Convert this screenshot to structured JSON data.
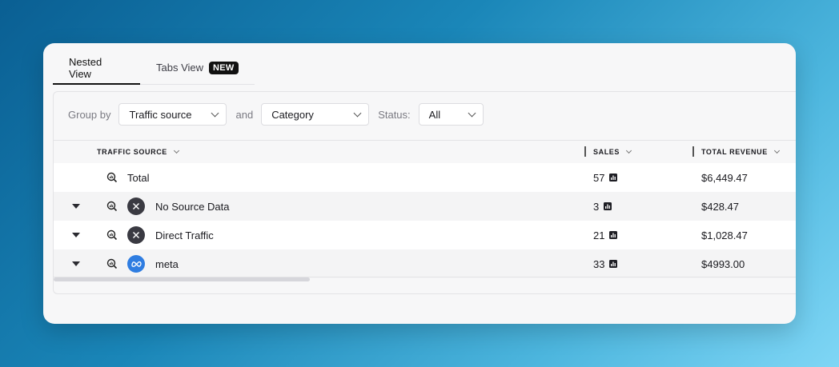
{
  "tabs": [
    {
      "label": "Nested View",
      "active": true
    },
    {
      "label": "Tabs View",
      "badge": "NEW",
      "active": false
    }
  ],
  "filters": {
    "group_by_label": "Group by",
    "group_by_value": "Traffic source",
    "and_label": "and",
    "category_value": "Category",
    "status_label": "Status:",
    "status_value": "All"
  },
  "table": {
    "columns": [
      "TRAFFIC SOURCE",
      "SALES",
      "TOTAL REVENUE"
    ],
    "rows": [
      {
        "name": "Total",
        "sales": "57",
        "revenue": "$6,449.47",
        "icon": "none",
        "expandable": false
      },
      {
        "name": "No Source Data",
        "sales": "3",
        "revenue": "$428.47",
        "icon": "close-icon",
        "expandable": true
      },
      {
        "name": "Direct Traffic",
        "sales": "21",
        "revenue": "$1,028.47",
        "icon": "close-icon",
        "expandable": true
      },
      {
        "name": "meta",
        "sales": "33",
        "revenue": "$4993.00",
        "icon": "meta-icon",
        "expandable": true
      }
    ]
  },
  "colors": {
    "meta_blue": "#2f7de1",
    "dark_icon": "#3a3a42"
  }
}
